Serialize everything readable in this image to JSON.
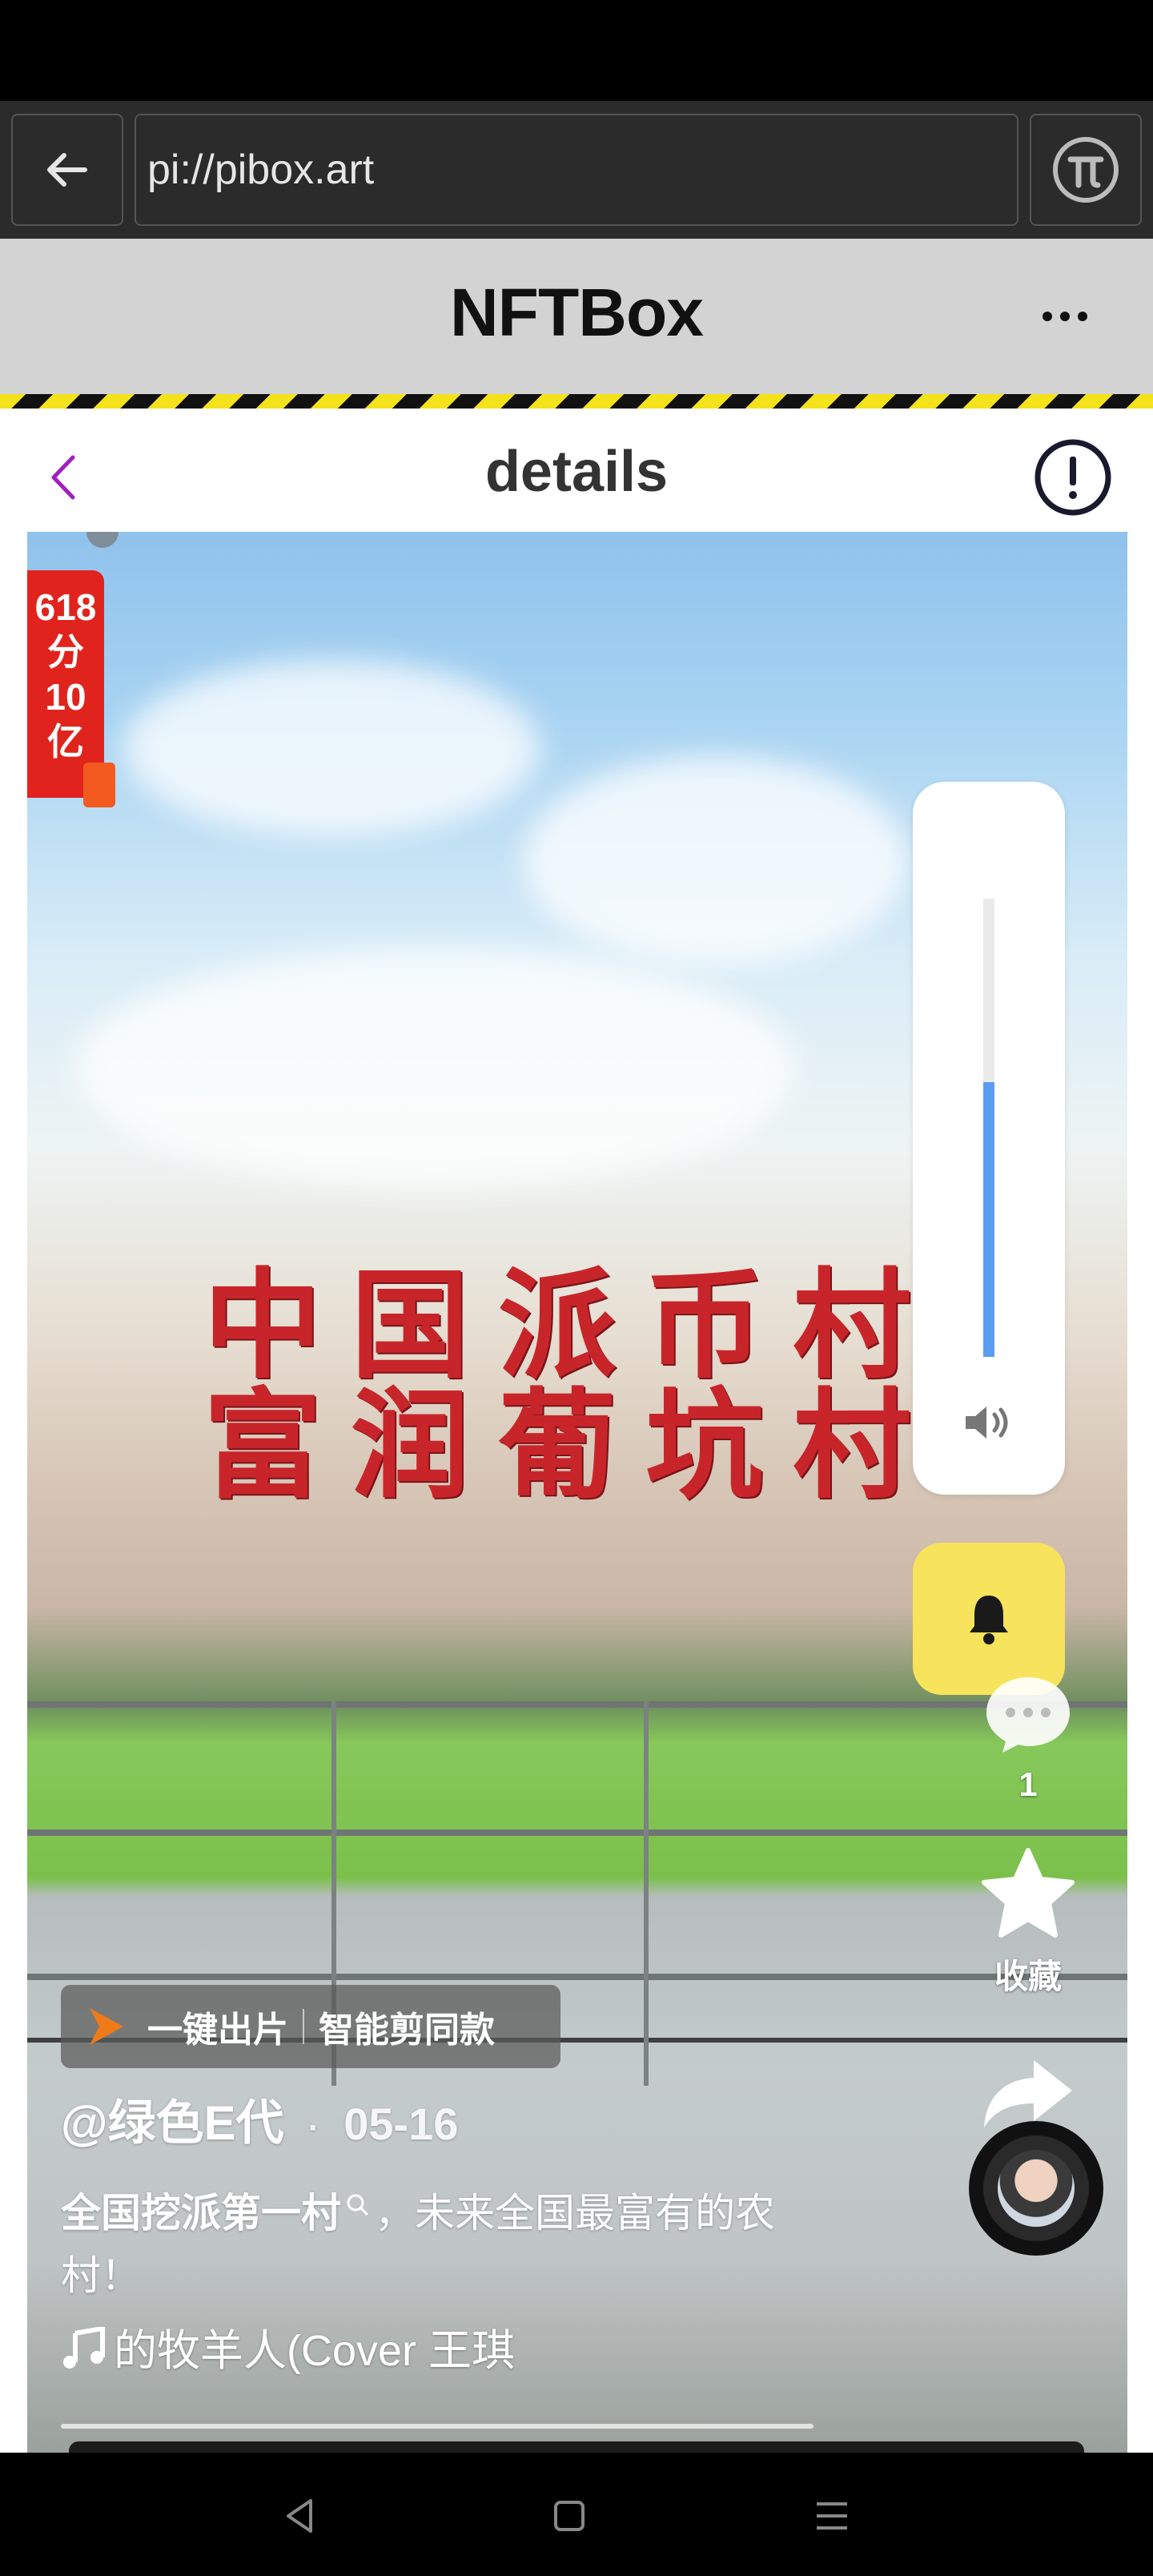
{
  "browser": {
    "url": "pi://pibox.art"
  },
  "app": {
    "title": "NFTBox"
  },
  "nav": {
    "title": "details"
  },
  "video": {
    "promo_lines": [
      "618",
      "分",
      "10",
      "亿"
    ],
    "stone_line_1": "中国派币村",
    "stone_line_2": "富润葡坑村",
    "volume_level": 0.6,
    "side": {
      "comment_count": "1",
      "favorite_label": "收藏",
      "share_label": "分享"
    },
    "tag_chip": {
      "left": "一键出片",
      "right": "智能剪同款"
    },
    "author": "@绿色E代",
    "separator": "·",
    "date": "05-16",
    "desc_bold": "全国挖派第一村",
    "desc_rest": "，未来全国最富有的农村！",
    "music": "的牧羊人(Cover 王琪"
  },
  "colors": {
    "accent": "#a020c0",
    "volume_fill": "#5c9cf0",
    "bell_bg": "#f7e35c",
    "hazard_yellow": "#f4e21a"
  }
}
